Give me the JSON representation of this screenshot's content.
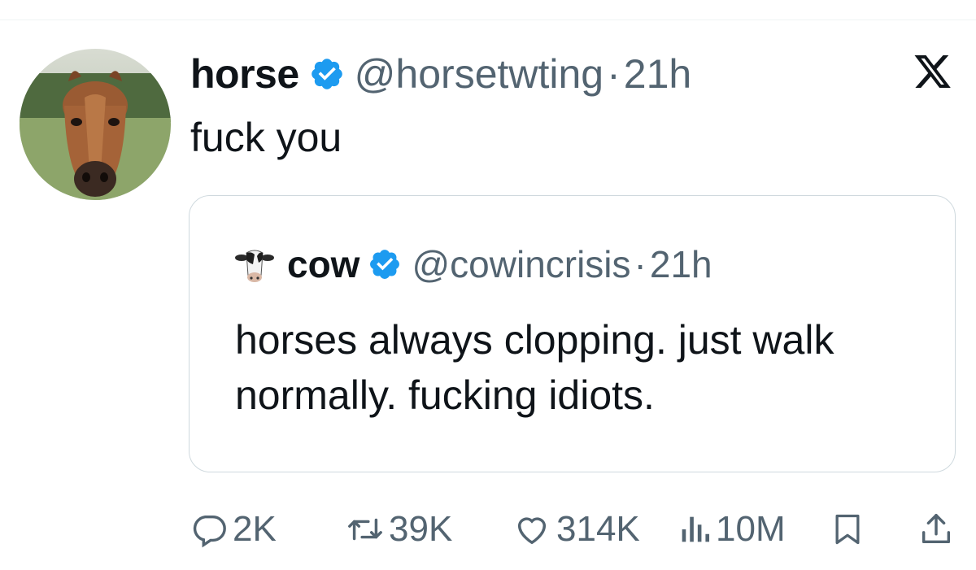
{
  "tweet": {
    "author": {
      "display_name": "horse",
      "handle": "@horsetwting",
      "verified": true,
      "avatar_icon": "horse-avatar-icon"
    },
    "separator": "·",
    "time": "21h",
    "text": "fuck you",
    "platform_icon": "x-logo-icon"
  },
  "quote": {
    "author": {
      "display_name": "cow",
      "handle": "@cowincrisis",
      "verified": true,
      "avatar_icon": "cow-avatar-icon"
    },
    "separator": "·",
    "time": "21h",
    "text": "horses always clopping. just walk normally. fucking idiots."
  },
  "actions": {
    "replies": {
      "icon": "reply-icon",
      "count": "2K"
    },
    "reposts": {
      "icon": "repost-icon",
      "count": "39K"
    },
    "likes": {
      "icon": "heart-icon",
      "count": "314K"
    },
    "views": {
      "icon": "views-icon",
      "count": "10M"
    },
    "bookmark": {
      "icon": "bookmark-icon"
    },
    "share": {
      "icon": "share-icon"
    }
  },
  "colors": {
    "verified_blue": "#1d9bf0",
    "secondary_text": "#536471",
    "border": "#cfd9de"
  }
}
